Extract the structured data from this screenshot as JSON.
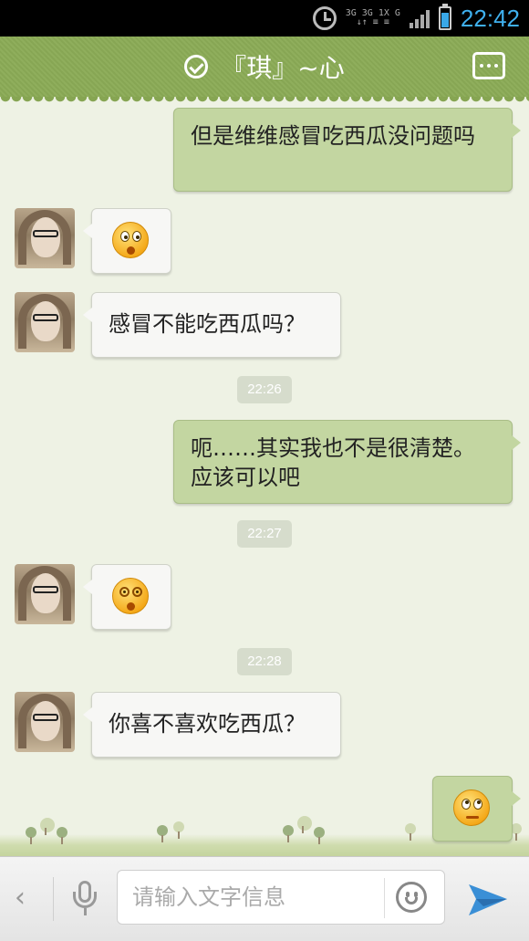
{
  "status_bar": {
    "network_top": "3G 3G 1X G",
    "network_bottom": "↓↑ ≡ ≡",
    "time": "22:42",
    "battery_level": 0.75
  },
  "header": {
    "title": "『琪』~心"
  },
  "messages": [
    {
      "side": "right",
      "type": "text",
      "text": "但是维维感冒吃西瓜没问题吗"
    },
    {
      "side": "left",
      "type": "emoji",
      "emoji": "surprised-emoji"
    },
    {
      "side": "left",
      "type": "text",
      "text": "感冒不能吃西瓜吗？"
    },
    {
      "type": "time",
      "text": "22:26"
    },
    {
      "side": "right",
      "type": "text",
      "text": "呃……其实我也不是很清楚。应该可以吧"
    },
    {
      "type": "time",
      "text": "22:27"
    },
    {
      "side": "left",
      "type": "emoji",
      "emoji": "dizzy-emoji"
    },
    {
      "type": "time",
      "text": "22:28"
    },
    {
      "side": "left",
      "type": "text",
      "text": "你喜不喜欢吃西瓜？"
    },
    {
      "side": "right",
      "type": "emoji",
      "emoji": "eye-roll-emoji"
    }
  ],
  "input_bar": {
    "placeholder": "请输入文字信息",
    "value": ""
  },
  "colors": {
    "header_green": "#8fae5c",
    "bubble_right": "#c3d6a1",
    "bubble_left": "#f7f7f5",
    "background": "#eef2e4",
    "send_blue": "#3a8fd6"
  }
}
